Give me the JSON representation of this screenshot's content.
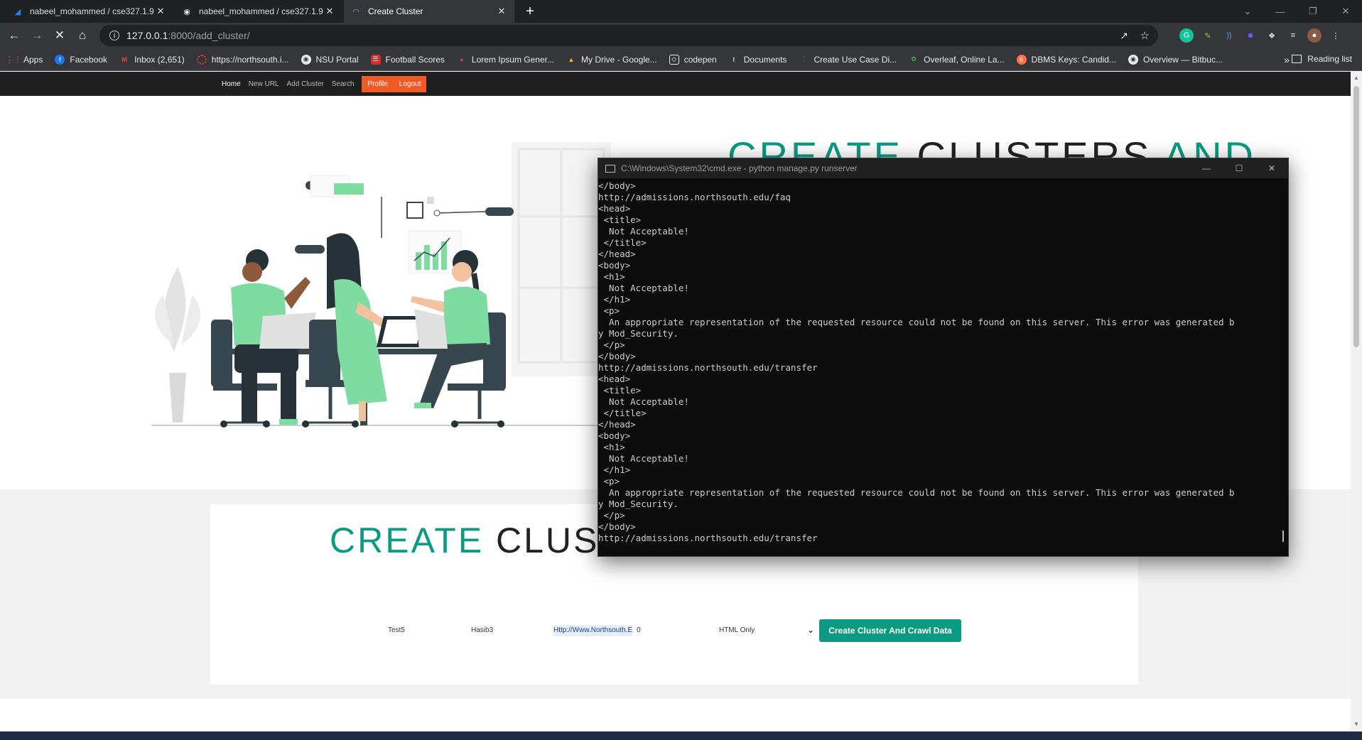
{
  "browser": {
    "tabs": [
      {
        "title": "nabeel_mohammed / cse327.1.9",
        "active": false
      },
      {
        "title": "nabeel_mohammed / cse327.1.9",
        "active": false
      },
      {
        "title": "Create Cluster",
        "active": true
      }
    ],
    "url_host": "127.0.0.1",
    "url_path": ":8000/add_cluster/",
    "bookmarks": [
      "Apps",
      "Facebook",
      "Inbox (2,651)",
      "https://northsouth.i...",
      "NSU Portal",
      "Football Scores",
      "Lorem Ipsum Gener...",
      "My Drive - Google...",
      "codepen",
      "Documents",
      "Create Use Case Di...",
      "Overleaf, Online La...",
      "DBMS Keys: Candid...",
      "Overview — Bitbuc..."
    ],
    "reading_list": "Reading list"
  },
  "site": {
    "nav": {
      "home": "Home",
      "new_url": "New URL",
      "add_cluster": "Add Cluster",
      "search": "Search",
      "profile": "Profile",
      "logout": "Logout"
    },
    "hero_title_accent_1": "CREATE",
    "hero_title_mid": " CLUSTERS ",
    "hero_title_accent_2": "AND",
    "form": {
      "title_accent": "CREATE",
      "title_rest": " CLUST",
      "field_1": "Test5",
      "field_2": "Hasib3",
      "field_3_selected": "Http://Www.Northsouth.E",
      "field_3_rest": "0",
      "select_value": "HTML Only",
      "submit": "Create Cluster And Crawl Data"
    }
  },
  "cmd": {
    "title": "C:\\Windows\\System32\\cmd.exe - python  manage.py runserver",
    "output": "</body>\nhttp://admissions.northsouth.edu/faq\n<head>\n <title>\n  Not Acceptable!\n </title>\n</head>\n<body>\n <h1>\n  Not Acceptable!\n </h1>\n <p>\n  An appropriate representation of the requested resource could not be found on this server. This error was generated b\ny Mod_Security.\n </p>\n</body>\nhttp://admissions.northsouth.edu/transfer\n<head>\n <title>\n  Not Acceptable!\n </title>\n</head>\n<body>\n <h1>\n  Not Acceptable!\n </h1>\n <p>\n  An appropriate representation of the requested resource could not be found on this server. This error was generated b\ny Mod_Security.\n </p>\n</body>\nhttp://admissions.northsouth.edu/transfer"
  },
  "colors": {
    "accent": "#0c9a83",
    "nav_pill": "#f05a24",
    "illustration_green": "#7fdca0"
  }
}
